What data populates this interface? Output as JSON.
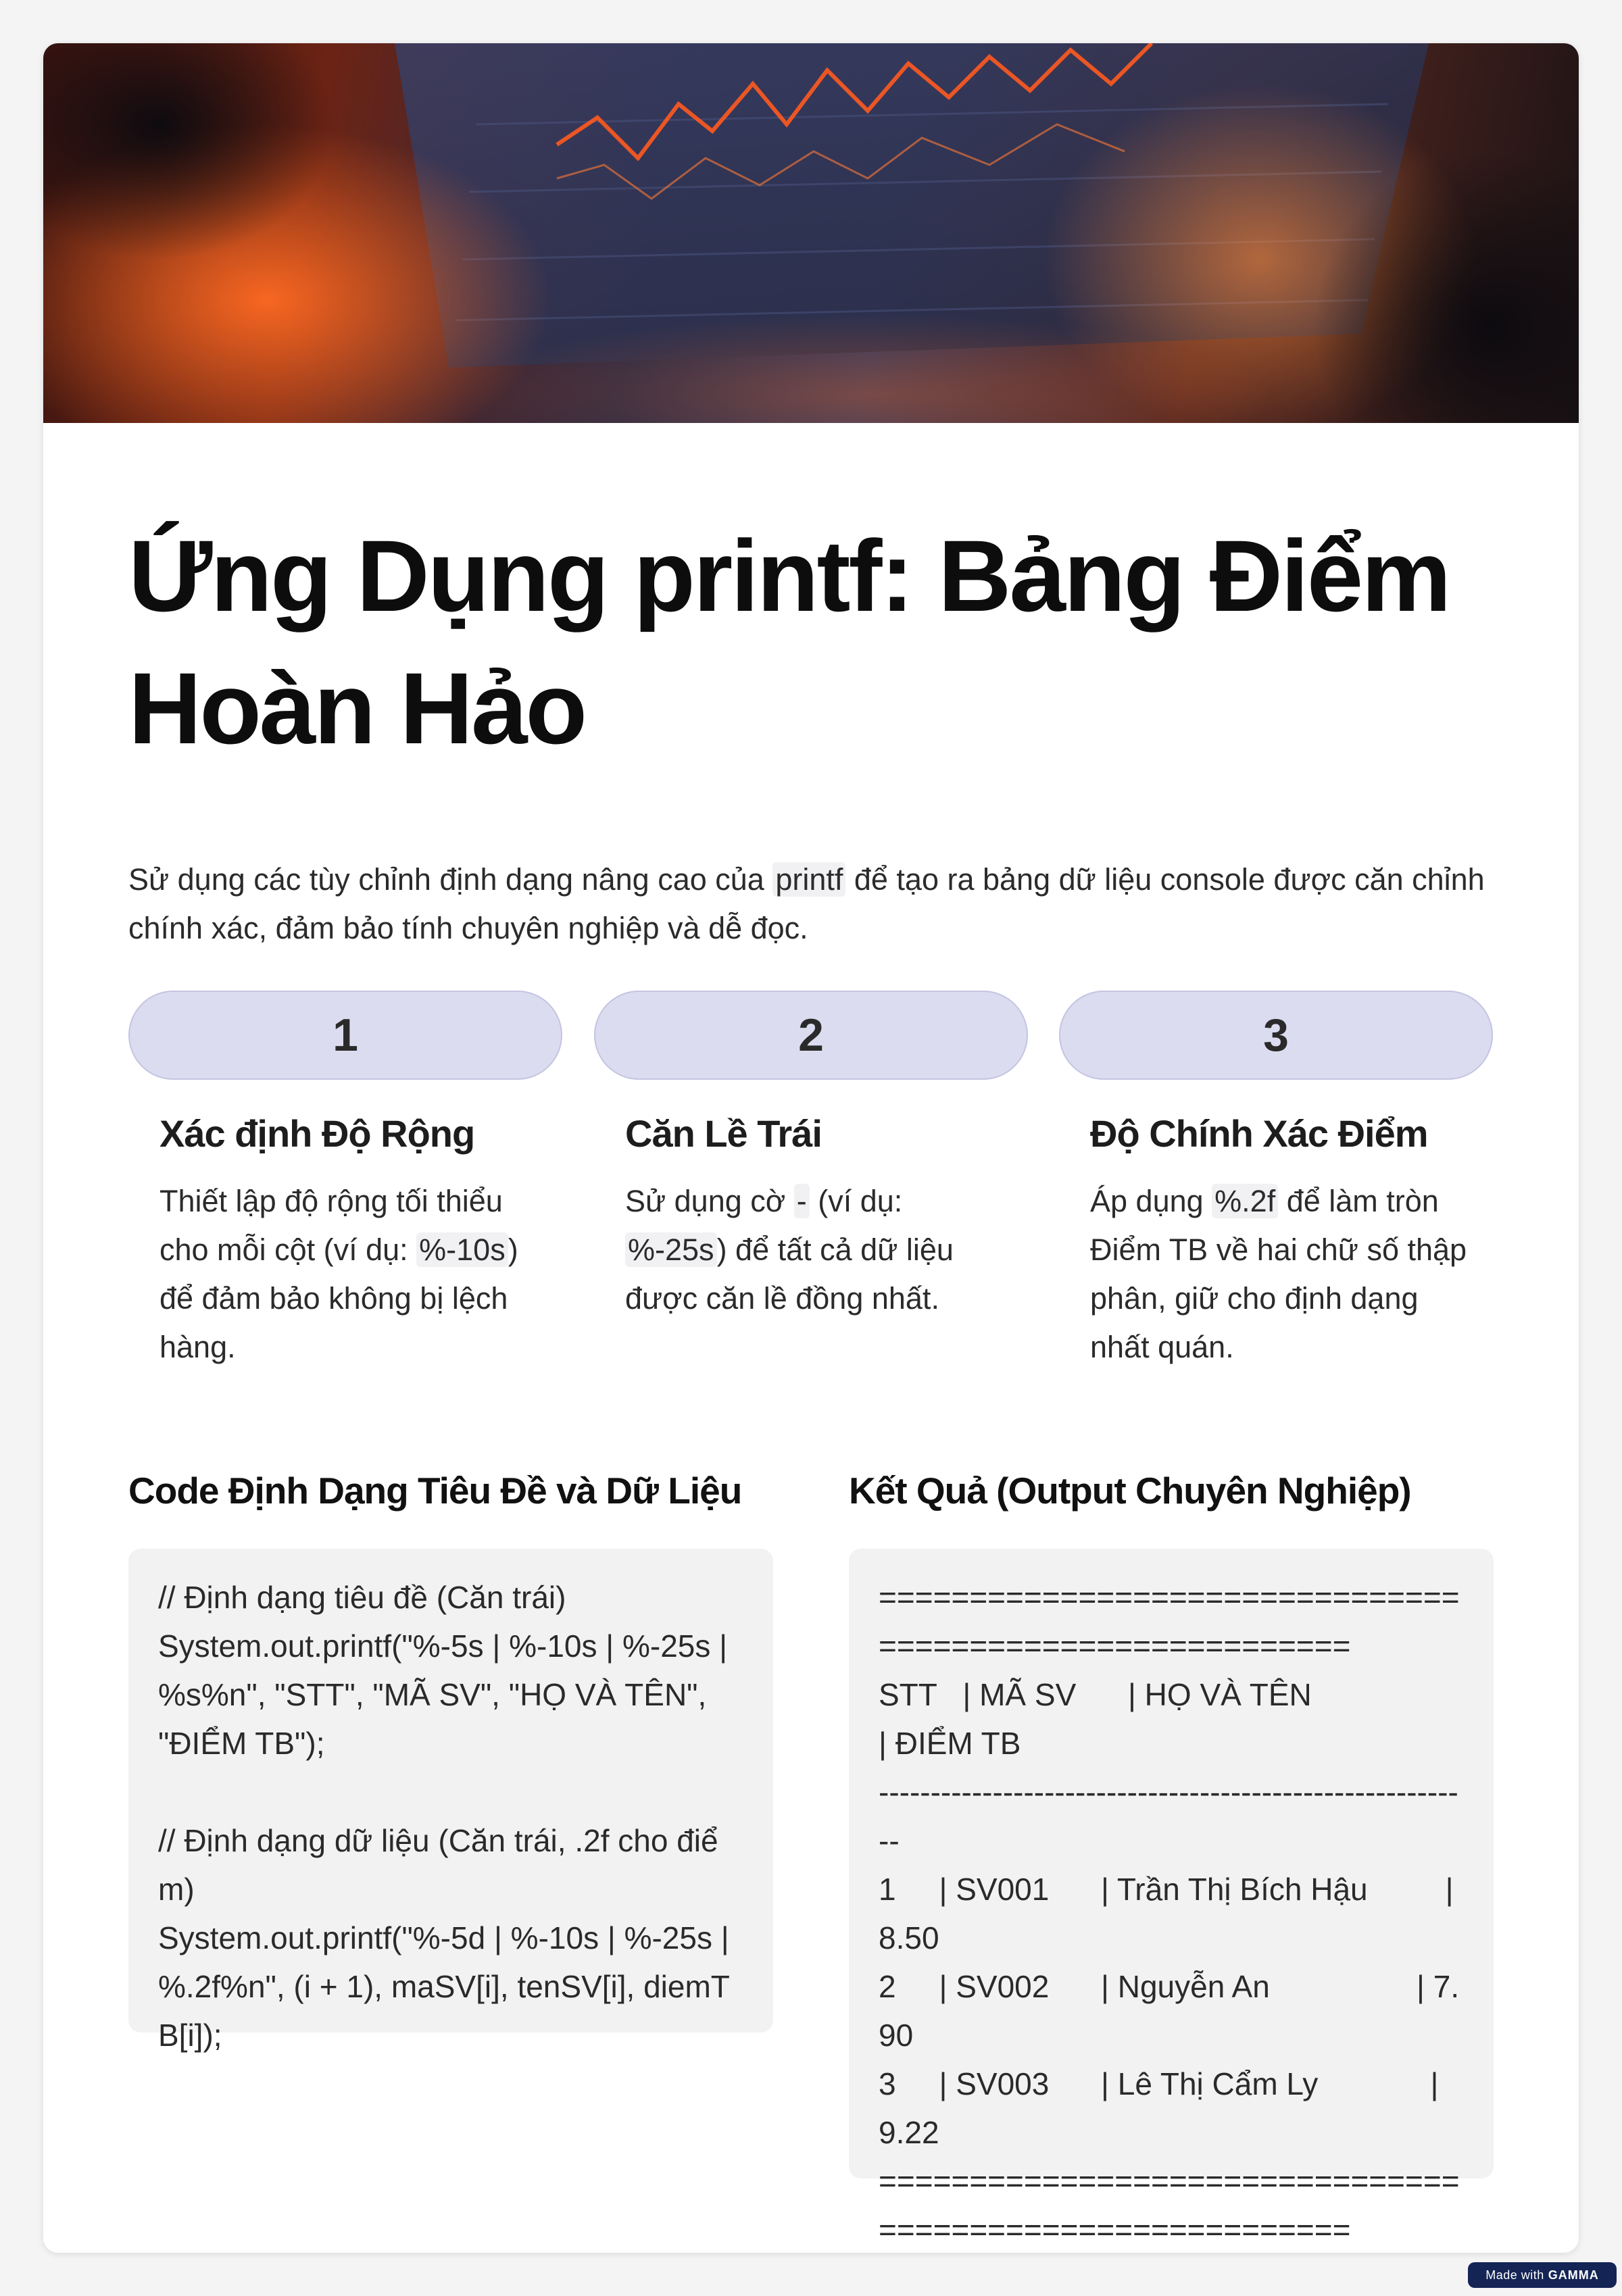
{
  "hero": {
    "image": "stock-chart-on-phone-photo",
    "colors": {
      "warm": "#ff5a1f",
      "cool": "#2e3350"
    }
  },
  "title": "Ứng Dụng printf: Bảng Điểm Hoàn Hảo",
  "intro": {
    "before": "Sử dụng các tùy chỉnh định dạng nâng cao của ",
    "code": "printf",
    "after": " để tạo ra bảng dữ liệu console được căn chỉnh chính xác, đảm bảo tính chuyên nghiệp và dễ đọc."
  },
  "steps": [
    {
      "number": "1",
      "title": "Xác định Độ Rộng",
      "body_before": "Thiết lập độ rộng tối thiểu cho mỗi cột (ví dụ: ",
      "body_code": "%-10s",
      "body_after": ") để đảm bảo không bị lệch hàng."
    },
    {
      "number": "2",
      "title": "Căn Lề Trái",
      "body_before": "Sử dụng cờ ",
      "body_code": "-",
      "body_middle": " (ví dụ: ",
      "body_code2": "%-25s",
      "body_after": ") để tất cả dữ liệu được căn lề đồng nhất."
    },
    {
      "number": "3",
      "title": "Độ Chính Xác Điểm",
      "body_before": "Áp dụng ",
      "body_code": "%.2f",
      "body_after": " để làm tròn Điểm TB về hai chữ số thập phân, giữ cho định dạng nhất quán."
    }
  ],
  "code_section": {
    "title": "Code Định Dạng Tiêu Đề và Dữ Liệu",
    "code": "// Định dạng tiêu đề (Căn trái)\nSystem.out.printf(\"%-5s | %-10s | %-25s | %s%n\", \"STT\", \"MÃ SV\", \"HỌ VÀ TÊN\", \"ĐIỂM TB\");\n\n// Định dạng dữ liệu (Căn trái, .2f cho điểm)\nSystem.out.printf(\"%-5d | %-10s | %-25s | %.2f%n\", (i + 1), maSV[i], tenSV[i], diemTB[i]);"
  },
  "output_section": {
    "title": "Kết Quả (Output Chuyên Nghiệp)",
    "output": "==========================================================\nSTT   | MÃ SV      | HỌ VÀ TÊN                 | ĐIỂM TB\n----------------------------------------------------------\n1     | SV001      | Trần Thị Bích Hậu         | 8.50\n2     | SV002      | Nguyễn An                 | 7.90\n3     | SV003      | Lê Thị Cẩm Ly             | 9.22\n=========================================================="
  },
  "badge": {
    "prefix": "Made with",
    "brand": "GAMMA"
  },
  "colors": {
    "pill": "#dcdcf0",
    "codebox": "#f2f2f3",
    "badge": "#142455"
  }
}
